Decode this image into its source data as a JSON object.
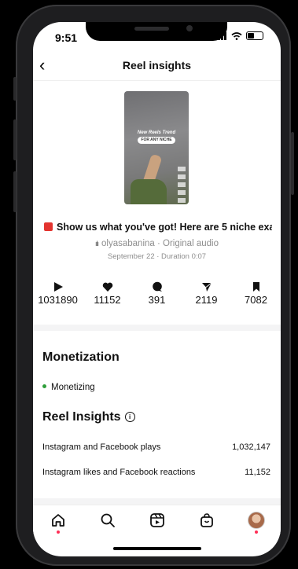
{
  "status_bar": {
    "time": "9:51"
  },
  "header": {
    "title": "Reel insights"
  },
  "reel": {
    "thumb_line1": "New Reels Trend",
    "thumb_line2": "FOR ANY NICHE",
    "caption": "Show us what you've got! Here are 5 niche exa...",
    "audio": "olyasabanina · Original audio",
    "meta": "September 22 · Duration 0:07"
  },
  "stats": {
    "plays": "1031890",
    "likes": "11152",
    "comments": "391",
    "shares": "2119",
    "saves": "7082"
  },
  "monetization": {
    "title": "Monetization",
    "status": "Monetizing",
    "status_color": "#2e9e3a"
  },
  "insights": {
    "title": "Reel Insights",
    "rows": [
      {
        "label": "Instagram and Facebook plays",
        "value": "1,032,147"
      },
      {
        "label": "Instagram likes and Facebook reactions",
        "value": "11,152"
      }
    ]
  },
  "icons": [
    "back-chevron-icon",
    "play-icon",
    "heart-icon",
    "comment-icon",
    "share-icon",
    "bookmark-icon",
    "info-icon",
    "home-icon",
    "search-icon",
    "reels-icon",
    "shop-icon",
    "profile-avatar"
  ]
}
